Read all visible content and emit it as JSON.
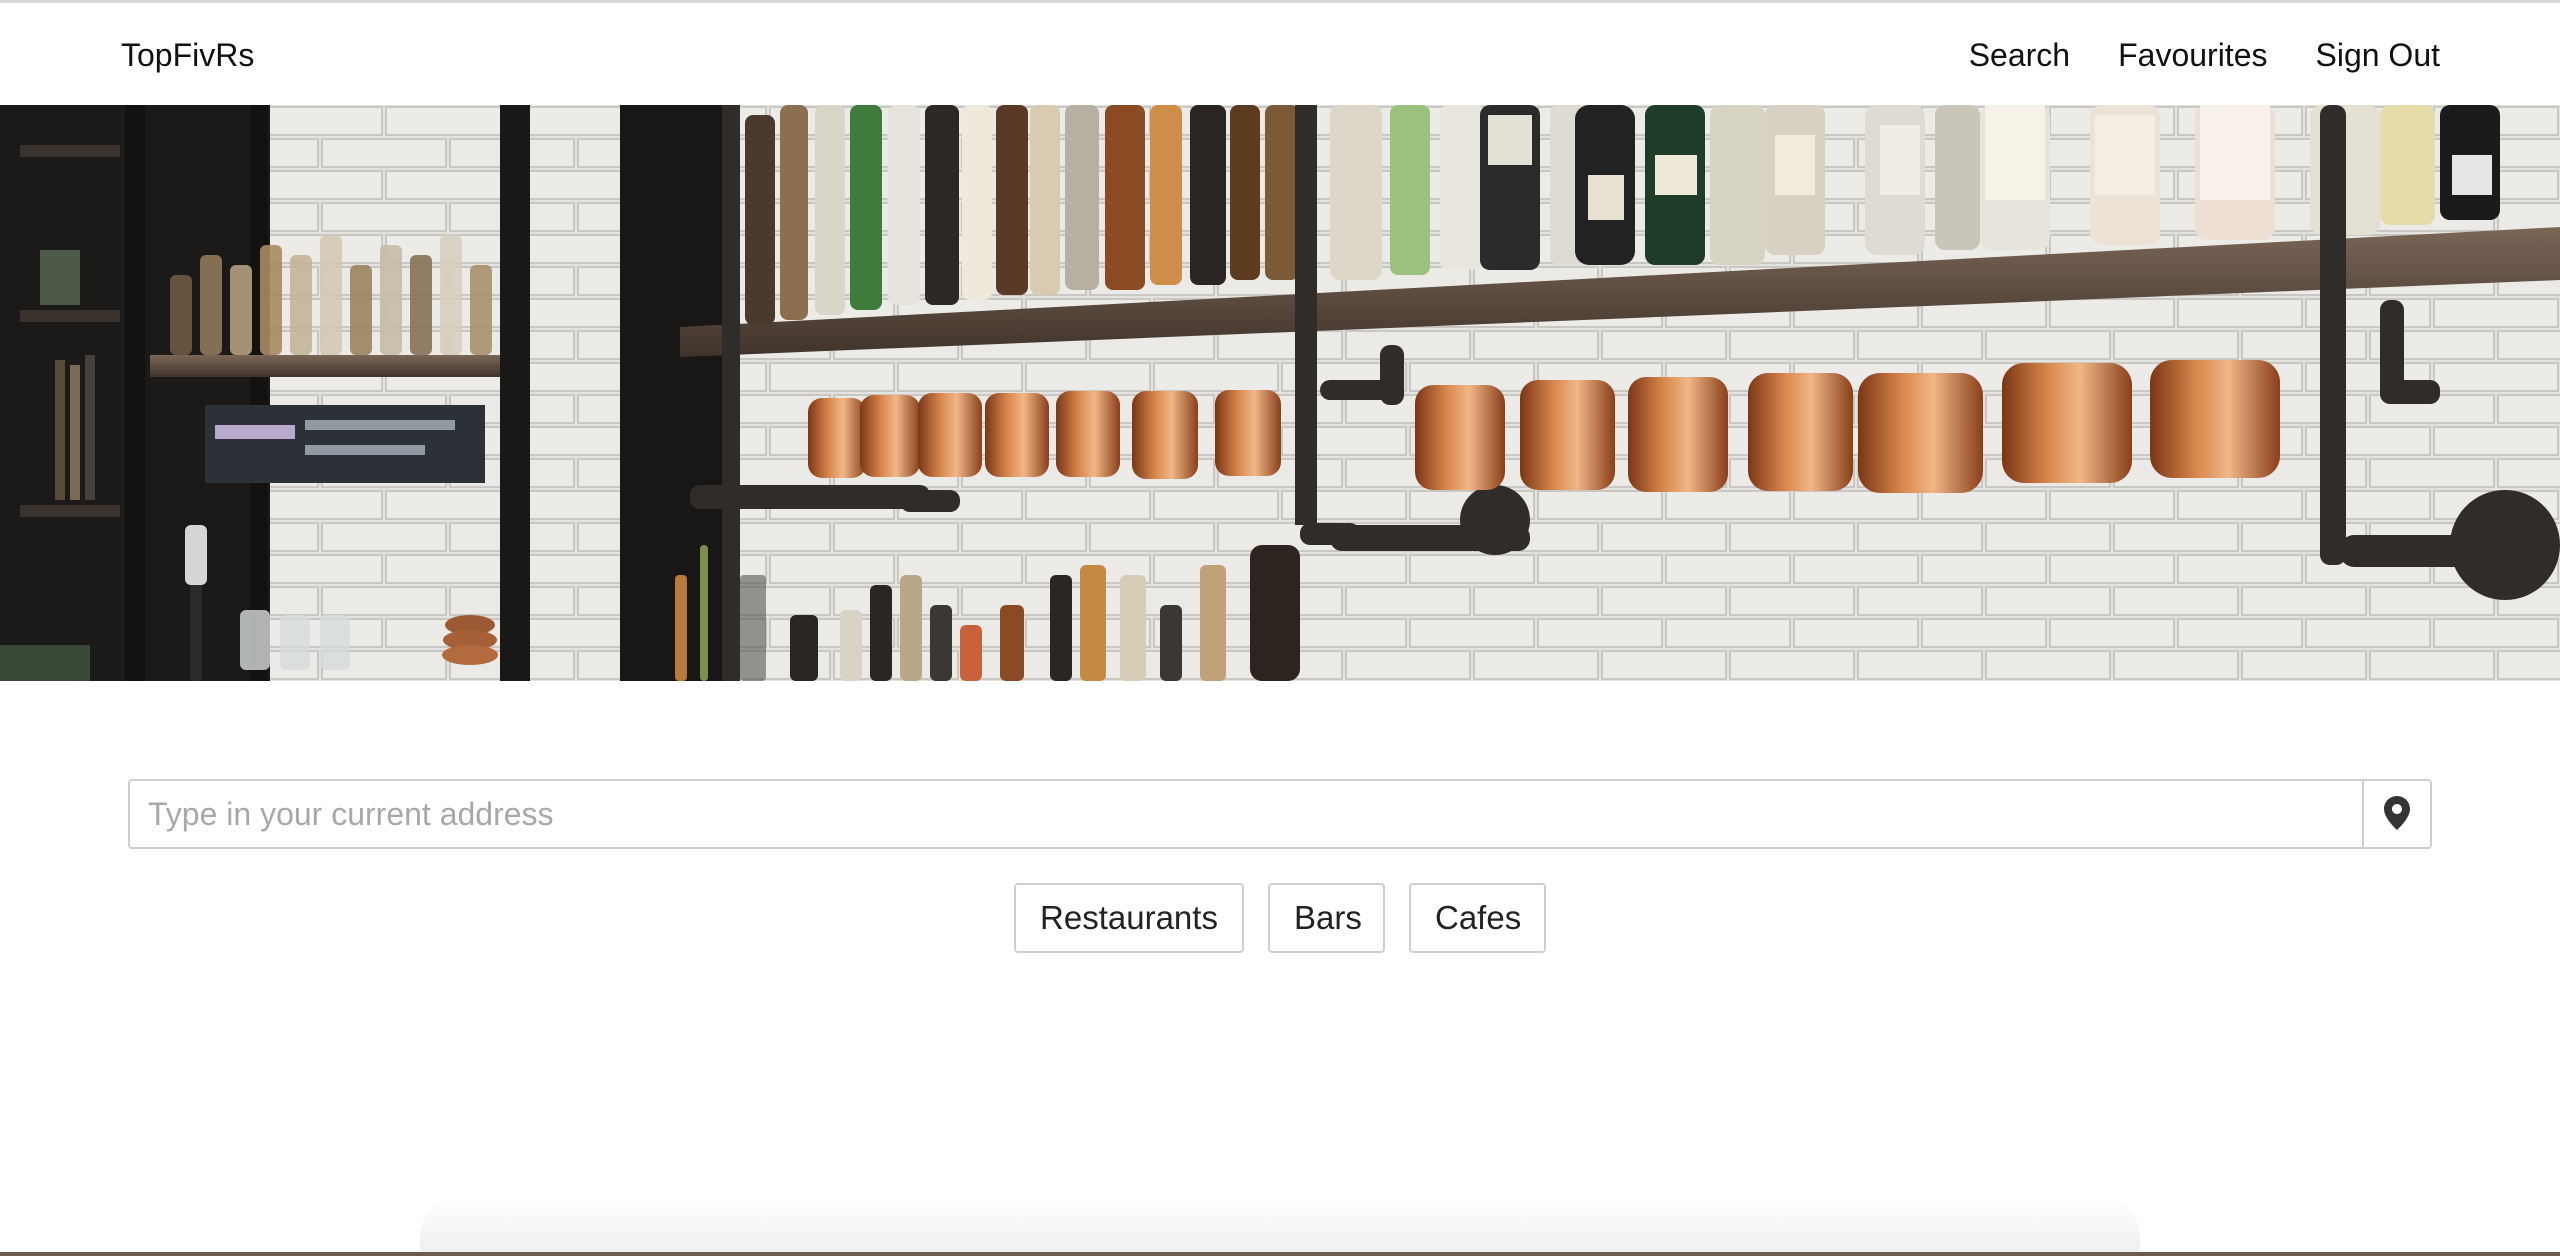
{
  "brand": "TopFivRs",
  "nav": {
    "search": "Search",
    "favourites": "Favourites",
    "sign_out": "Sign Out"
  },
  "hero": {
    "image": "bar-shelves-with-bottles-and-copper-mugs"
  },
  "search": {
    "placeholder": "Type in your current address",
    "value": "",
    "locate_icon": "map-marker-icon"
  },
  "categories": {
    "restaurants": "Restaurants",
    "bars": "Bars",
    "cafes": "Cafes"
  },
  "colors": {
    "copper": "#c8713a",
    "tile": "#e6e5e2",
    "shelf": "#5c4a3d",
    "pipe": "#2e2b29"
  }
}
